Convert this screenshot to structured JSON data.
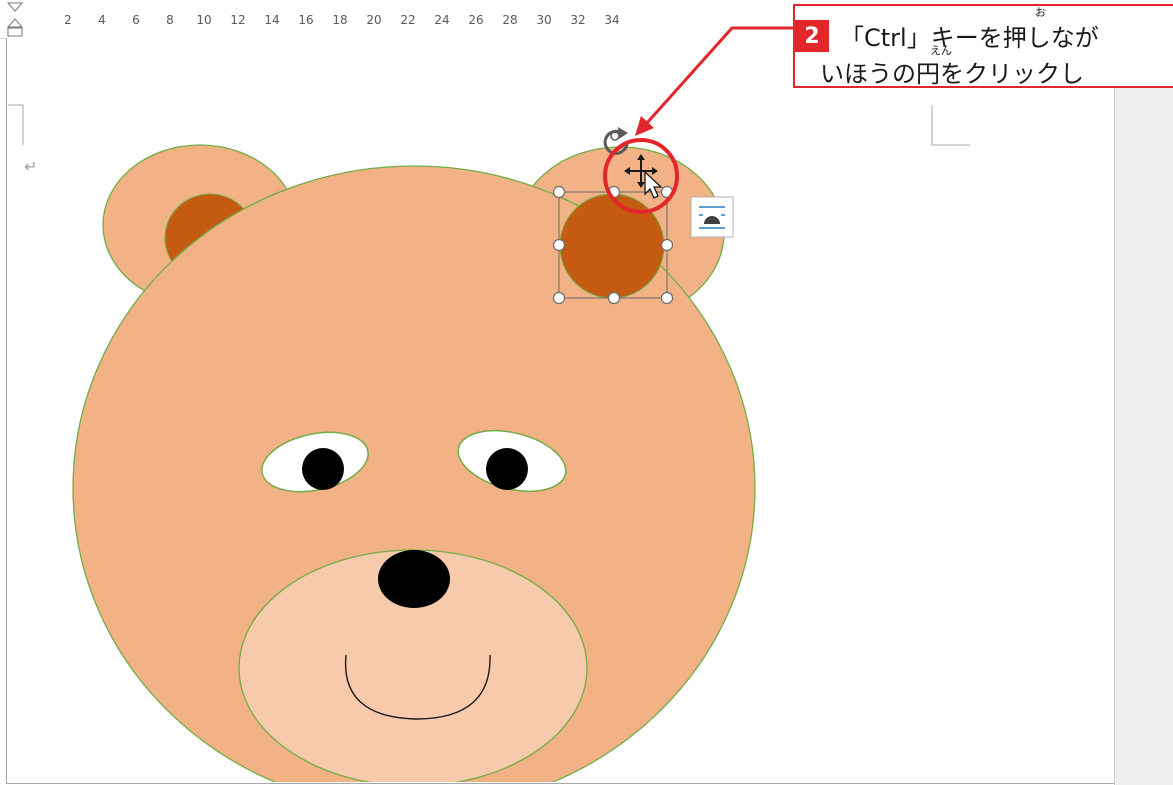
{
  "ruler": {
    "numbers": [
      "2",
      "4",
      "6",
      "8",
      "10",
      "12",
      "14",
      "16",
      "18",
      "20",
      "22",
      "24",
      "26",
      "28",
      "30",
      "32",
      "34"
    ]
  },
  "callout": {
    "step_number": "2",
    "line1": "「Ctrl」キーを押しなが",
    "line2": "いほうの円をクリックし",
    "ruby_push": "お",
    "ruby_en": "えん"
  },
  "paragraph_mark": "↵",
  "colors": {
    "callout_red": "#e2262b",
    "bear_fur": "#f2b285",
    "bear_inner_ear": "#c55a11",
    "muzzle": "#f7caac",
    "outline": "#70ad47",
    "eye_white": "#ffffff",
    "pupil": "#000000"
  },
  "icons": {
    "rotate_handle": "rotate-icon",
    "move_cursor": "move-cursor-icon",
    "layout_options": "layout-options-icon"
  }
}
